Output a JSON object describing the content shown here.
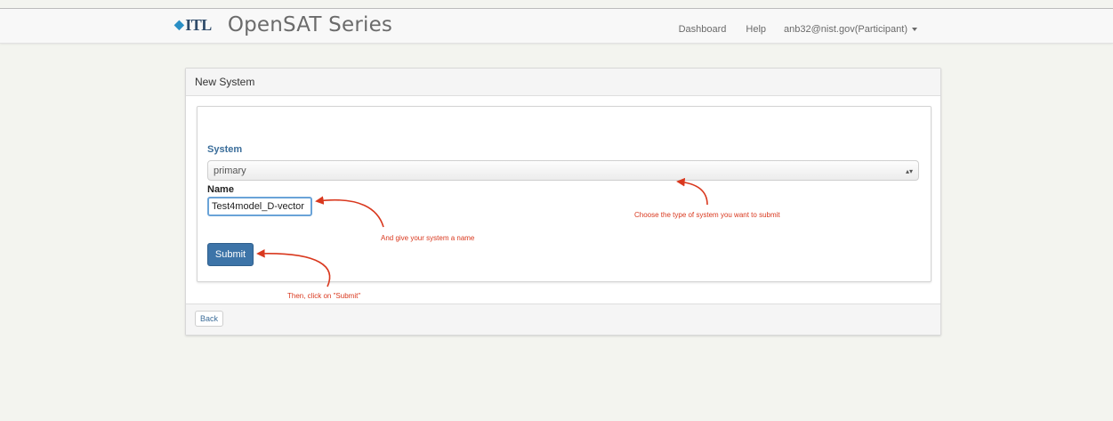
{
  "navbar": {
    "logo_text": "ITL",
    "title": "OpenSAT Series",
    "links": [
      "Dashboard",
      "Help"
    ],
    "user": "anb32@nist.gov(Participant)"
  },
  "panel": {
    "heading": "New System",
    "system_label": "System",
    "system_value": "primary",
    "name_label": "Name",
    "name_value": "Test4model_D-vector",
    "submit_label": "Submit",
    "back_label": "Back"
  },
  "annotations": {
    "system_hint": "Choose the type of system you want to submit",
    "name_hint": "And give your system a name",
    "submit_hint": "Then, click on \"Submit\""
  },
  "colors": {
    "annotation": "#d9381e",
    "primary_button": "#3d74a8",
    "label_blue": "#3a6d9a"
  }
}
